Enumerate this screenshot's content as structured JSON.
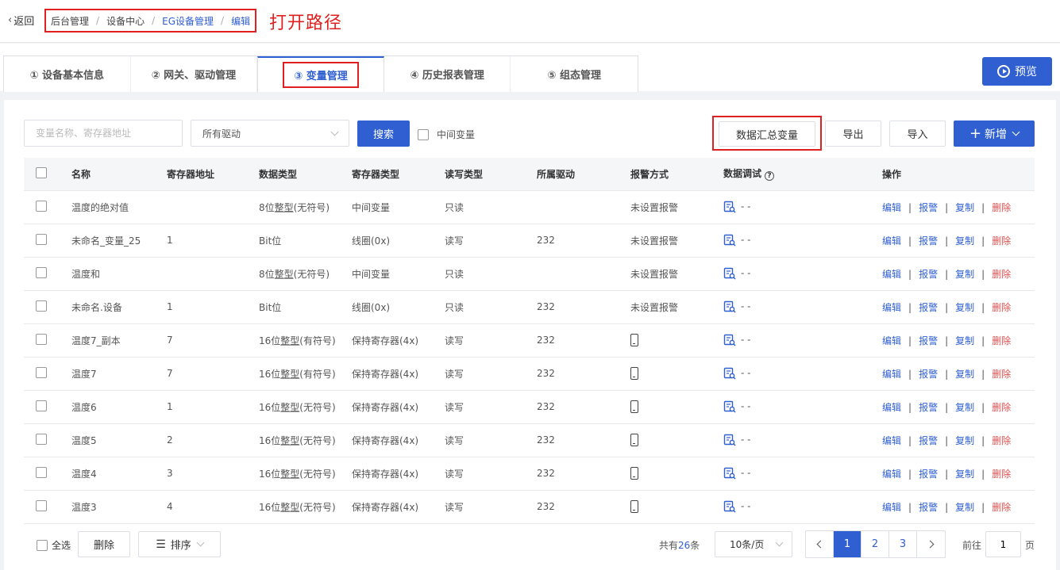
{
  "header": {
    "back_label": "返回",
    "breadcrumb": [
      "后台管理",
      "设备中心",
      "EG设备管理",
      "编辑"
    ],
    "annotation": "打开路径"
  },
  "tabs": [
    {
      "label": "① 设备基本信息"
    },
    {
      "label": "② 网关、驱动管理"
    },
    {
      "label": "③ 变量管理"
    },
    {
      "label": "④ 历史报表管理"
    },
    {
      "label": "⑤ 组态管理"
    }
  ],
  "active_tab": 2,
  "preview_label": "预览",
  "toolbar": {
    "search_placeholder": "变量名称、寄存器地址",
    "driver_select": "所有驱动",
    "search_label": "搜索",
    "mid_var_label": "中间变量",
    "summary_label": "数据汇总变量",
    "export_label": "导出",
    "import_label": "导入",
    "add_label": "新增"
  },
  "columns": [
    "名称",
    "寄存器地址",
    "数据类型",
    "寄存器类型",
    "读写类型",
    "所属驱动",
    "报警方式",
    "数据调试",
    "操作"
  ],
  "rows": [
    {
      "name": "温度的绝对值",
      "addr": "",
      "dtype": "8位整型(无符号)",
      "rtype": "中间变量",
      "rw": "只读",
      "driver": "",
      "alarm": "未设置报警",
      "debug": "- -"
    },
    {
      "name": "未命名_变量_25",
      "addr": "1",
      "dtype": "Bit位",
      "rtype": "线圈(0x)",
      "rw": "读写",
      "driver": "232",
      "alarm": "未设置报警",
      "debug": "- -"
    },
    {
      "name": "温度和",
      "addr": "",
      "dtype": "8位整型(无符号)",
      "rtype": "中间变量",
      "rw": "只读",
      "driver": "",
      "alarm": "未设置报警",
      "debug": "- -"
    },
    {
      "name": "未命名.设备",
      "addr": "1",
      "dtype": "Bit位",
      "rtype": "线圈(0x)",
      "rw": "只读",
      "driver": "232",
      "alarm": "未设置报警",
      "debug": "- -"
    },
    {
      "name": "温度7_副本",
      "addr": "7",
      "dtype": "16位整型(有符号)",
      "rtype": "保持寄存器(4x)",
      "rw": "读写",
      "driver": "232",
      "alarm": "",
      "debug": "- -"
    },
    {
      "name": "温度7",
      "addr": "7",
      "dtype": "16位整型(有符号)",
      "rtype": "保持寄存器(4x)",
      "rw": "读写",
      "driver": "232",
      "alarm": "",
      "debug": "- -"
    },
    {
      "name": "温度6",
      "addr": "1",
      "dtype": "16位整型(无符号)",
      "rtype": "保持寄存器(4x)",
      "rw": "读写",
      "driver": "232",
      "alarm": "",
      "debug": "- -"
    },
    {
      "name": "温度5",
      "addr": "2",
      "dtype": "16位整型(无符号)",
      "rtype": "保持寄存器(4x)",
      "rw": "读写",
      "driver": "232",
      "alarm": "",
      "debug": "- -"
    },
    {
      "name": "温度4",
      "addr": "3",
      "dtype": "16位整型(无符号)",
      "rtype": "保持寄存器(4x)",
      "rw": "读写",
      "driver": "232",
      "alarm": "",
      "debug": "- -"
    },
    {
      "name": "温度3",
      "addr": "4",
      "dtype": "16位整型(无符号)",
      "rtype": "保持寄存器(4x)",
      "rw": "读写",
      "driver": "232",
      "alarm": "",
      "debug": "- -"
    }
  ],
  "row_actions": [
    "编辑",
    "报警",
    "复制",
    "删除"
  ],
  "footer": {
    "select_all": "全选",
    "delete_label": "删除",
    "sort_label": "排序",
    "total_prefix": "共有",
    "total_count": "26",
    "total_suffix": "条",
    "page_size": "10条/页",
    "pages": [
      "1",
      "2",
      "3"
    ],
    "current_page": "1",
    "goto_prefix": "前往",
    "goto_value": "1",
    "goto_suffix": "页"
  },
  "colors": {
    "accent": "#2f5fd0",
    "annotation": "#e02020",
    "danger": "#e05050"
  }
}
